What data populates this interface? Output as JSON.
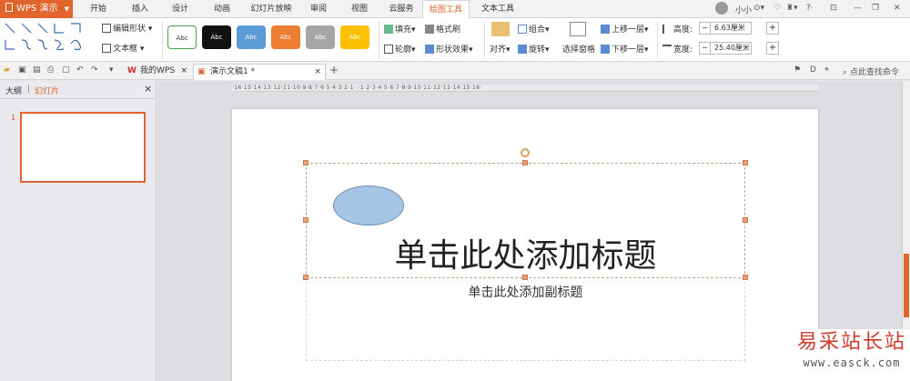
{
  "menu": {
    "app_button": "WPS 演示",
    "tabs": [
      "开始",
      "插入",
      "设计",
      "动画",
      "幻灯片放映",
      "审阅",
      "视图",
      "云服务",
      "绘图工具",
      "文本工具"
    ],
    "active_tab": "绘图工具",
    "user": "小小"
  },
  "ribbon": {
    "edit_shape": "编辑形状",
    "text_box": "文本框",
    "style_label": "Abc",
    "fill": "填充",
    "format_brush": "格式刷",
    "outline": "轮廓",
    "shape_effect": "形状效果",
    "align": "对齐",
    "group": "组合",
    "rotate": "旋转",
    "selection_pane": "选择窗格",
    "bring_forward": "上移一层",
    "send_backward": "下移一层",
    "height_label": "高度:",
    "height_value": "6.63厘米",
    "width_label": "宽度:",
    "width_value": "25.40厘米",
    "minus": "−",
    "plus": "+"
  },
  "doctabs": {
    "my_wps": "我的WPS",
    "current_doc": "演示文稿1 *",
    "close": "×",
    "new_tab": "+",
    "find_command": "点此查找命令"
  },
  "leftpanel": {
    "tab_outline": "大纲",
    "tab_slides": "幻灯片",
    "close": "×",
    "slide_number": "1"
  },
  "ruler": "·16·15·14·13·12·11·10·9·8·7·6·5·4·3·2·1· ·1·2·3·4·5·6·7·8·9·10·11·12·13·14·15·16·",
  "slide": {
    "title_placeholder": "单击此处添加标题",
    "subtitle_placeholder": "单击此处添加副标题"
  },
  "watermark": {
    "line1": "易采站长站",
    "line2": "www.easck.com"
  },
  "colors": {
    "accent": "#e0642b",
    "ellipse_fill": "#a6c4e5"
  }
}
